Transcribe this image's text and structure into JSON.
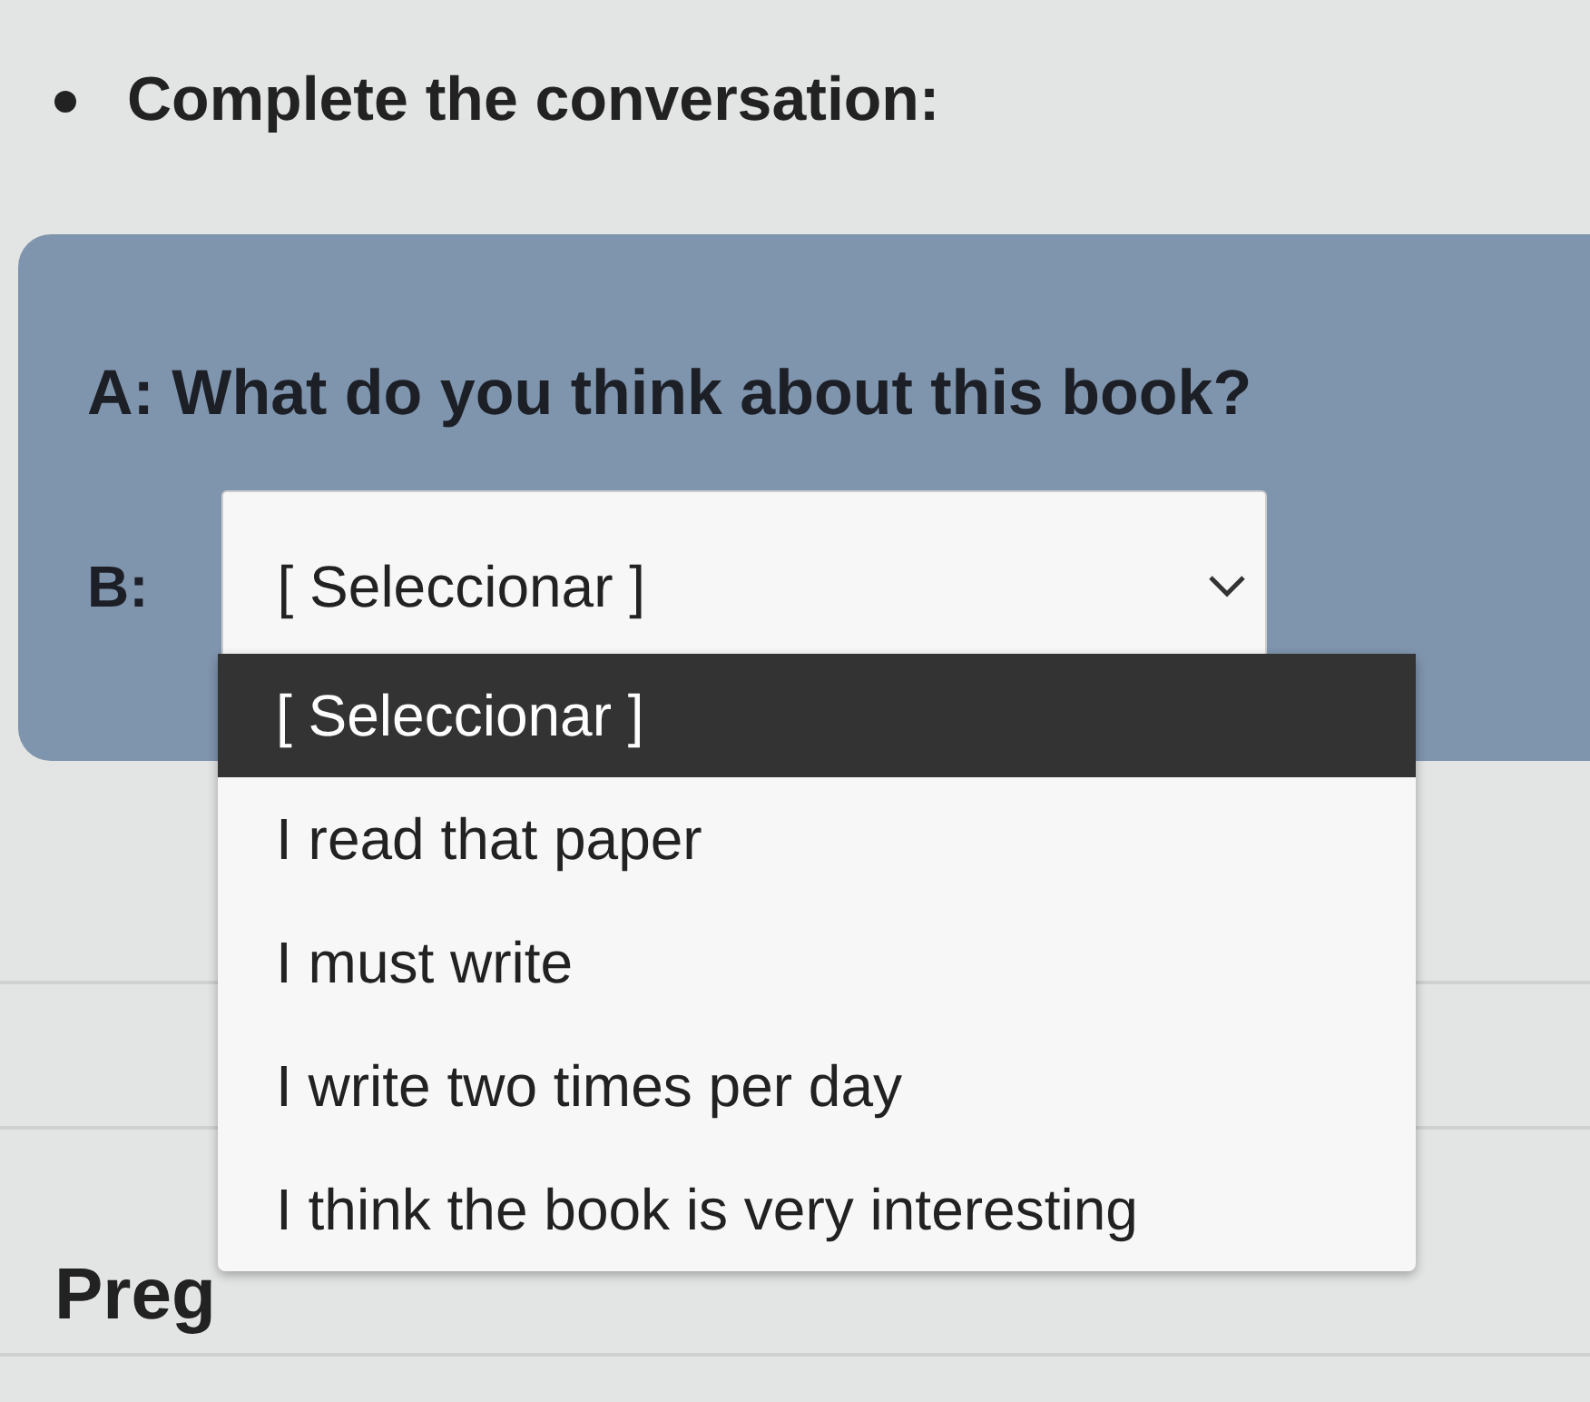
{
  "instruction": {
    "text": "Complete the conversation:"
  },
  "dialogue": {
    "line_a": "A: What do you think about this book?",
    "label_b": "B:",
    "select": {
      "value": "[ Seleccionar ]",
      "expanded": true,
      "options": [
        {
          "label": "[ Seleccionar ]",
          "selected": true
        },
        {
          "label": "I read that paper",
          "selected": false
        },
        {
          "label": "I must write",
          "selected": false
        },
        {
          "label": "I write two times per day",
          "selected": false
        },
        {
          "label": "I think the book is very interesting",
          "selected": false
        }
      ]
    }
  },
  "next_heading": "Preg"
}
